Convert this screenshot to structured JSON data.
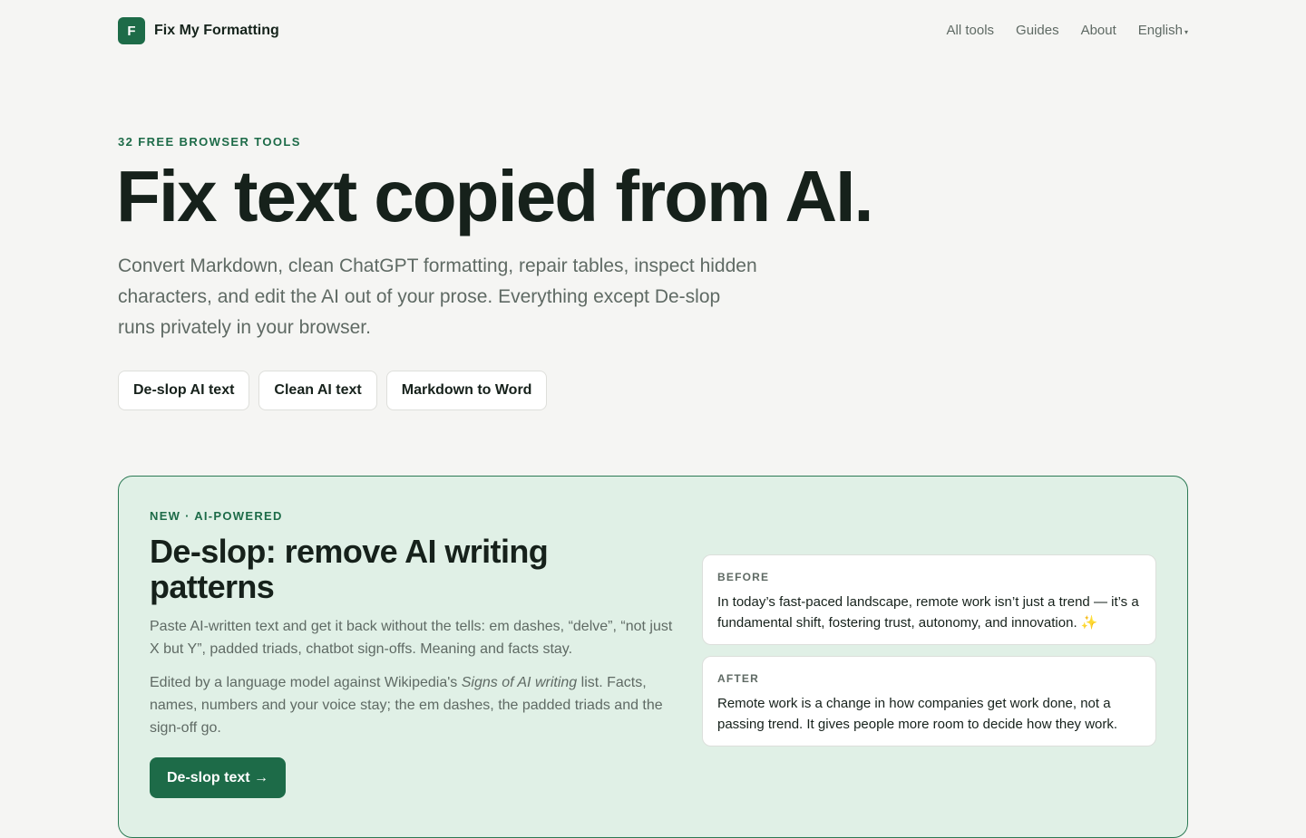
{
  "header": {
    "logo_letter": "F",
    "brand": "Fix My Formatting",
    "nav": [
      "All tools",
      "Guides",
      "About"
    ],
    "language": "English",
    "language_caret": "▾"
  },
  "hero": {
    "eyebrow": "32 FREE BROWSER TOOLS",
    "title": "Fix text copied from AI.",
    "subtitle": "Convert Markdown, clean ChatGPT formatting, repair tables, inspect hidden characters, and edit the AI out of your prose. Everything except De-slop runs privately in your browser.",
    "buttons": [
      "De-slop AI text",
      "Clean AI text",
      "Markdown to Word"
    ]
  },
  "promo": {
    "eyebrow": "NEW · AI-POWERED",
    "title": "De-slop: remove AI writing patterns",
    "description": "Paste AI-written text and get it back without the tells: em dashes, “delve”, “not just X but Y”, padded triads, chatbot sign-offs. Meaning and facts stay.",
    "description2_before": "Edited by a language model against Wikipedia's ",
    "description2_emphasis": "Signs of AI writing",
    "description2_after": " list. Facts, names, numbers and your voice stay; the em dashes, the padded triads and the sign-off go.",
    "cta": "De-slop text →",
    "before": {
      "label": "BEFORE",
      "text": "In today’s fast-paced landscape, remote work isn’t just a trend — it’s a fundamental shift, fostering trust, autonomy, and innovation. ✨"
    },
    "after": {
      "label": "AFTER",
      "text": "Remote work is a change in how companies get work done, not a passing trend. It gives people more room to decide how they work."
    }
  },
  "colors": {
    "background": "#f5f5f3",
    "accent": "#1d6b48",
    "promo_background": "#e0f0e6",
    "text": "#16211b",
    "muted_text": "#5f6a64"
  }
}
